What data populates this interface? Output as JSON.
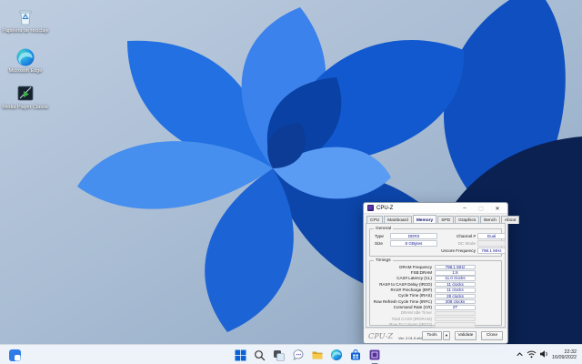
{
  "desktop": {
    "icons": [
      {
        "label": "Papelera de reciclaje"
      },
      {
        "label": "Microsoft Edge"
      },
      {
        "label": "Media Player Classic"
      }
    ]
  },
  "window": {
    "title": "CPU-Z",
    "tabs": [
      "CPU",
      "Mainboard",
      "Memory",
      "SPD",
      "Graphics",
      "Bench",
      "About"
    ],
    "active_tab": "Memory",
    "general": {
      "legend": "General",
      "type_label": "Type",
      "type_value": "DDR3",
      "size_label": "Size",
      "size_value": "8 GBytes",
      "channel_label": "Channel #",
      "channel_value": "Dual",
      "dc_mode_label": "DC Mode",
      "dc_mode_value": "",
      "uncore_label": "Uncore Frequency",
      "uncore_value": "798.1 MHz"
    },
    "timings": {
      "legend": "Timings",
      "rows": [
        {
          "label": "DRAM Frequency",
          "value": "798.1 MHz"
        },
        {
          "label": "FSB:DRAM",
          "value": "1:6"
        },
        {
          "label": "CAS# Latency (CL)",
          "value": "11.0 clocks"
        },
        {
          "label": "RAS# to CAS# Delay (tRCD)",
          "value": "11 clocks"
        },
        {
          "label": "RAS# Precharge (tRP)",
          "value": "11 clocks"
        },
        {
          "label": "Cycle Time (tRAS)",
          "value": "28 clocks"
        },
        {
          "label": "Row Refresh Cycle Time (tRFC)",
          "value": "208 clocks"
        },
        {
          "label": "Command Rate (CR)",
          "value": "2T"
        },
        {
          "label": "DRAM Idle Timer",
          "value": ""
        },
        {
          "label": "Total CAS# (tRDRAM)",
          "value": ""
        },
        {
          "label": "Row To Column (tRCD)",
          "value": ""
        }
      ]
    },
    "footer": {
      "logo": "CPU-Z",
      "version": "Ver. 2.01.0.x64",
      "tools_label": "Tools",
      "drop_glyph": "▼",
      "validate_label": "Validate",
      "close_label": "Close"
    },
    "caption": {
      "minimize": "–",
      "maximize": "▢",
      "close": "✕"
    }
  },
  "taskbar": {
    "icons": [
      "widgets",
      "start",
      "search",
      "task-view",
      "chat",
      "file-explorer",
      "edge",
      "store",
      "cpu-z"
    ],
    "time": "22:32",
    "date": "16/09/2022"
  },
  "colors": {
    "accent_blue": "#1259cf",
    "dark_navy": "#0a2152",
    "taskbar_bg": "#f1f6fb",
    "value_text": "#141496"
  }
}
